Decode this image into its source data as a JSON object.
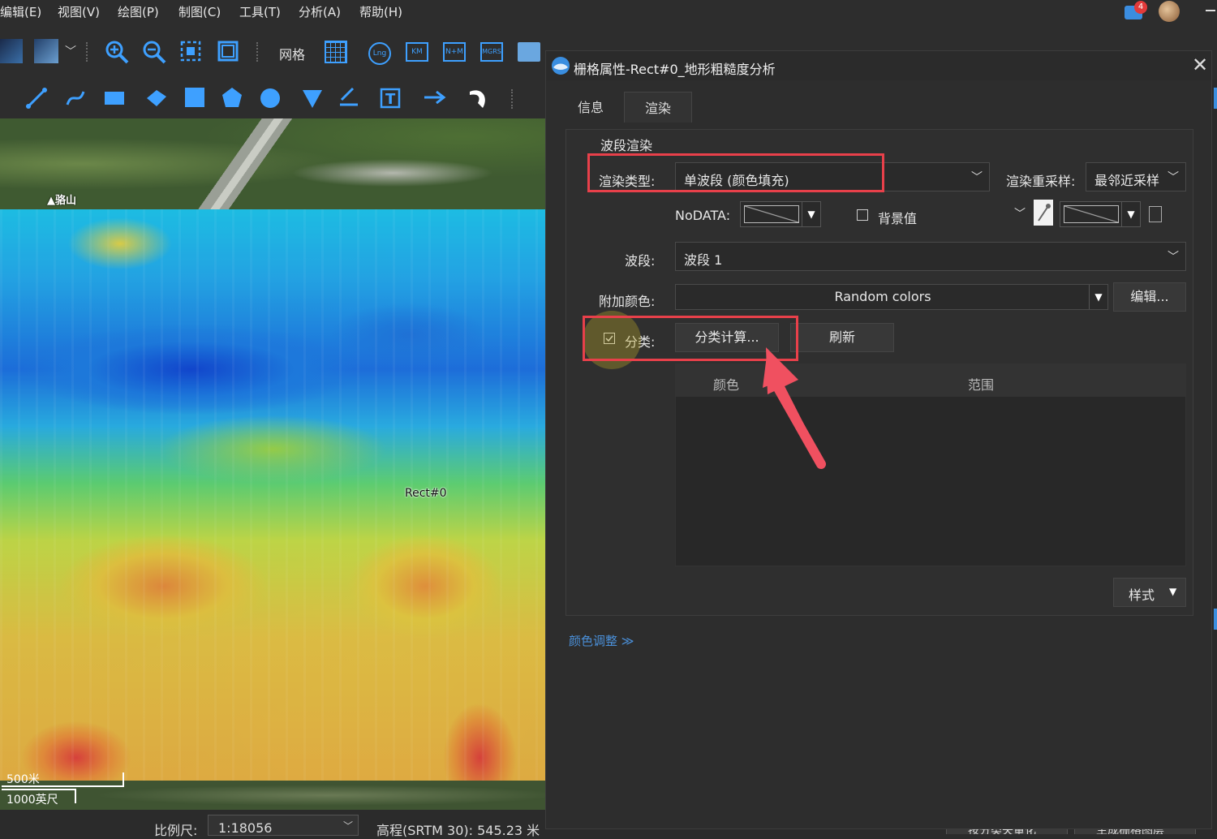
{
  "menubar": {
    "items": [
      "编辑(E)",
      "视图(V)",
      "绘图(P)",
      "制图(C)",
      "工具(T)",
      "分析(A)",
      "帮助(H)"
    ],
    "notification_count": "4"
  },
  "toolbar": {
    "grid_label": "网格",
    "lng_label": "Lng",
    "km_label": "KM",
    "nm_label": "N+M",
    "mgrs_label": "MGRS"
  },
  "map": {
    "place_label": "▲骆山",
    "object_label": "Rect#0",
    "scale_500": "500米",
    "scale_1000": "1000英尺"
  },
  "status": {
    "scale_label": "比例尺:",
    "scale_value": "1:18056",
    "elevation": "高程(SRTM 30): 545.23 米",
    "btn_vectorize": "按分类矢量化",
    "btn_generate": "生成栅格图层"
  },
  "dialog": {
    "title": "栅格属性-Rect#0_地形粗糙度分析",
    "tabs": [
      "信息",
      "渲染"
    ],
    "section_title": "波段渲染",
    "render_type_label": "渲染类型:",
    "render_type_value": "单波段 (颜色填充)",
    "resample_label": "渲染重采样:",
    "resample_value": "最邻近采样",
    "nodata_label": "NoDATA:",
    "bg_label": "背景值",
    "band_label": "波段:",
    "band_value": "波段 1",
    "color_label": "附加颜色:",
    "color_value": "Random colors",
    "edit_btn": "编辑...",
    "classify_label": "分类:",
    "classify_btn": "分类计算...",
    "refresh_btn": "刷新",
    "col_color": "颜色",
    "col_range": "范围",
    "style_btn": "样式",
    "color_adjust": "颜色调整 ≫"
  },
  "colors": {
    "accent": "#3ea0ff",
    "highlight": "#e8404a",
    "link": "#4a8fd8"
  }
}
